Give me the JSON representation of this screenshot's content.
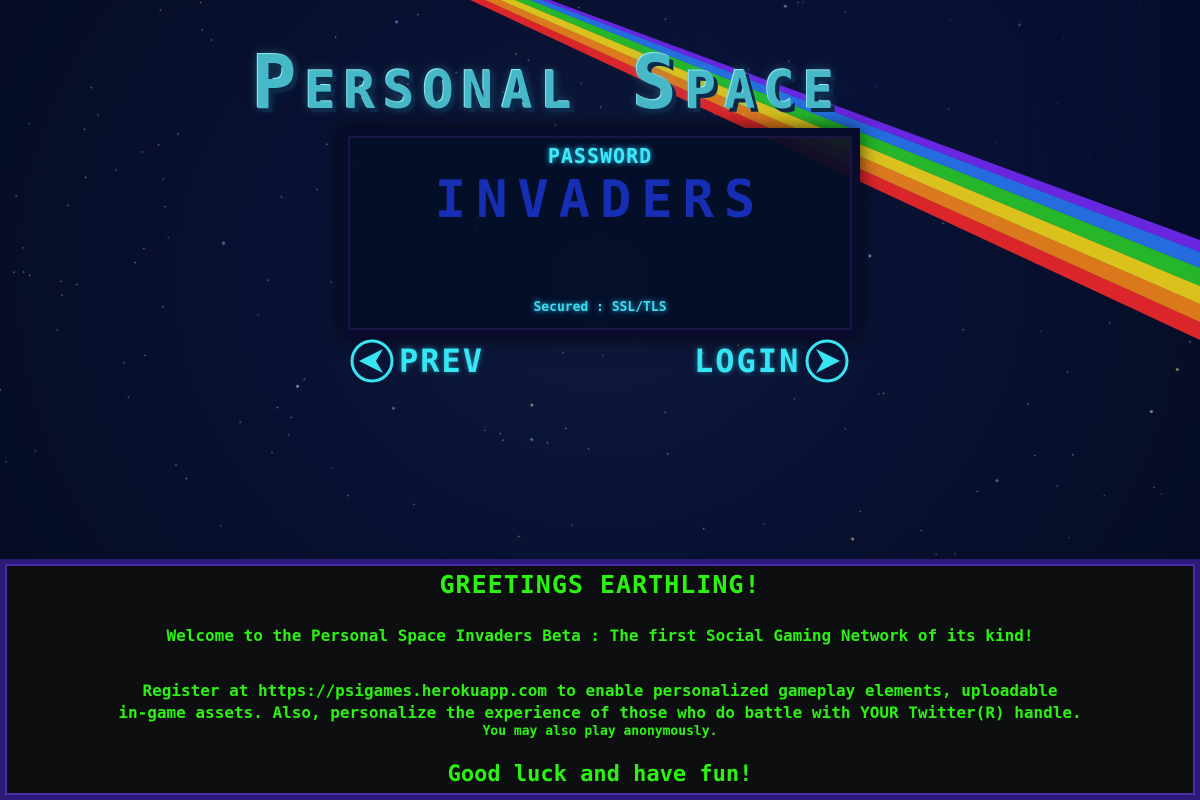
{
  "game": {
    "title": "Personal Space"
  },
  "login": {
    "field_label": "PASSWORD",
    "password_placeholder": "INVADERS",
    "security_note": "Secured : SSL/TLS",
    "prev_label": "PREV",
    "login_label": "LOGIN"
  },
  "message": {
    "heading": "GREETINGS EARTHLING!",
    "welcome": "Welcome to the Personal Space Invaders Beta : The first Social Gaming Network of its kind!",
    "register_line1": "Register at https://psigames.herokuapp.com to enable personalized gameplay elements, uploadable",
    "register_line2": "in-game assets. Also, personalize the experience of those who do battle with YOUR Twitter(R) handle.",
    "anonymous": "You may also play anonymously.",
    "closing": "Good luck and have fun!"
  },
  "icons": {
    "prev": "left-arrow-circle-icon",
    "login": "right-arrow-circle-icon"
  },
  "colors": {
    "title": "#46b8c8",
    "accent_cyan": "#36e6f5",
    "password_text": "#1730c8",
    "message_text": "#2cf212",
    "message_border": "#2c1a78",
    "panel_border": "#090b2c",
    "space_bg": "#060a22"
  }
}
